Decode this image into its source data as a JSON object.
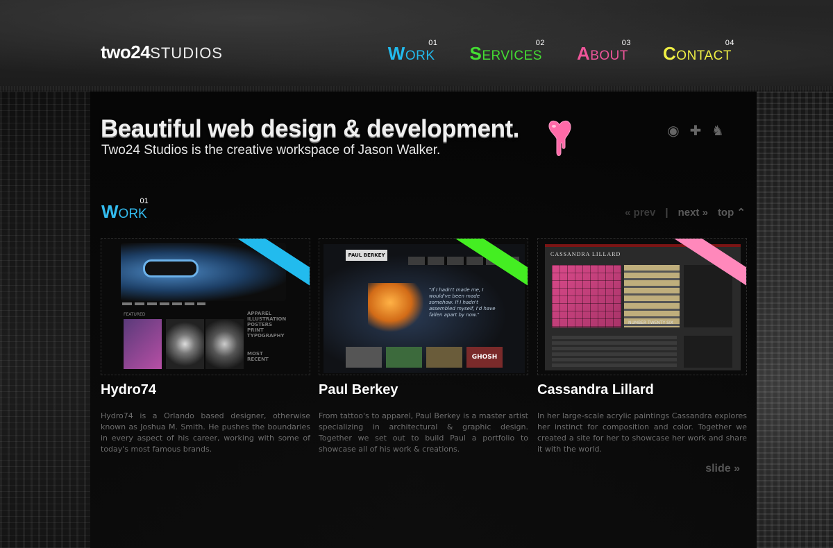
{
  "brand": {
    "logo_bold": "two24",
    "logo_light": "STUDIOS"
  },
  "nav": [
    {
      "first": "W",
      "rest": "ORK",
      "num": "01",
      "color": "#22bbee"
    },
    {
      "first": "S",
      "rest": "ERVICES",
      "num": "02",
      "color": "#44dd33"
    },
    {
      "first": "A",
      "rest": "BOUT",
      "num": "03",
      "color": "#ee5599"
    },
    {
      "first": "C",
      "rest": "ONTACT",
      "num": "04",
      "color": "#eeee44"
    }
  ],
  "hero": {
    "title": "Beautiful web design & development.",
    "subtitle": "Two24 Studios is the creative workspace of Jason Walker."
  },
  "platform_icons": [
    "disc-icon",
    "gamepad-icon",
    "android-icon",
    "apple-icon"
  ],
  "section": {
    "first": "W",
    "rest": "ORK",
    "num": "01"
  },
  "pager": {
    "prev": "« prev",
    "sep": "|",
    "next": "next »",
    "top": "top ⌃"
  },
  "works": [
    {
      "title": "Hydro74",
      "ribbon_color": "#22bbee",
      "description": "Hydro74 is a Orlando based designer, otherwise known as Joshua M. Smith. He pushes the boundaries in every aspect of his career, working with some of today's most famous brands.",
      "thumb": {
        "list": [
          "APPAREL",
          "ILLUSTRATION",
          "POSTERS",
          "PRINT",
          "TYPOGRAPHY"
        ],
        "most": [
          "MOST",
          "RECENT"
        ],
        "featured": "FEATURED"
      }
    },
    {
      "title": "Paul Berkey",
      "ribbon_color": "#44ee22",
      "description": "From tattoo's to apparel, Paul Berkey is a master artist specializing in architectural & graphic design. Together we set out to build Paul a portfolio to showcase all of his work & creations.",
      "thumb": {
        "logo": "PAUL BERKEY",
        "quote": "\"If I hadn't made me, I would've been made somehow. If I hadn't assembled myself, I'd have fallen apart by now.\"",
        "strip_label": "GHOSH"
      }
    },
    {
      "title": "Cassandra Lillard",
      "ribbon_color": "#ff88bb",
      "description": "In her large-scale acrylic paintings Cassandra explores her instinct for composition and color. Together we created a site for her to showcase her work and share it with the world.",
      "thumb": {
        "heading": "CASSANDRA LILLARD",
        "caption": "NUMBER TWENTY SIX"
      }
    }
  ],
  "slide": "slide »"
}
